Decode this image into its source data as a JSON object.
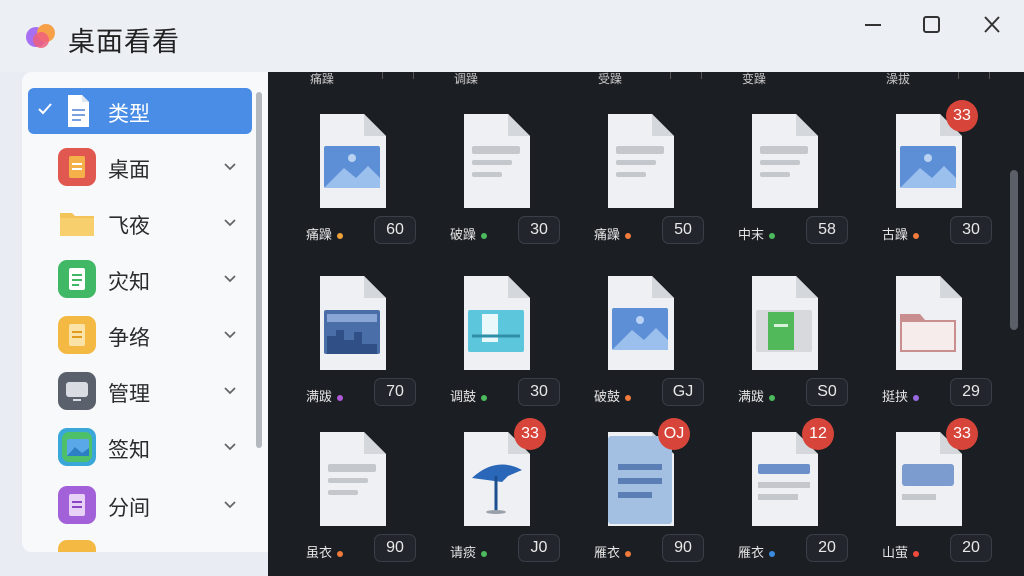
{
  "window": {
    "title": "桌面看看"
  },
  "sidebar": {
    "items": [
      {
        "label": "类型",
        "icon": "document-icon",
        "color": "#ffffff",
        "selected": true
      },
      {
        "label": "桌面",
        "icon": "files-icon",
        "color": "#e0584f"
      },
      {
        "label": "飞夜",
        "icon": "folder-icon",
        "color": "#f3c45a"
      },
      {
        "label": "灾知",
        "icon": "sheet-icon",
        "color": "#41b866"
      },
      {
        "label": "争络",
        "icon": "notes-icon",
        "color": "#f4b943"
      },
      {
        "label": "管理",
        "icon": "monitor-icon",
        "color": "#5b616c"
      },
      {
        "label": "签知",
        "icon": "gallery-icon",
        "color": "#3aa7d9"
      },
      {
        "label": "分间",
        "icon": "purple-doc-icon",
        "color": "#a261d8"
      }
    ]
  },
  "grid": {
    "top_fragments": [
      "痛躁",
      "调躁",
      "受躁",
      "变躁",
      "澡拔"
    ],
    "rows": [
      [
        {
          "name": "痛躁",
          "count": "60",
          "dot": "#f0a23a",
          "type": "image"
        },
        {
          "name": "破躁",
          "count": "30",
          "dot": "#4bbb5e",
          "type": "text"
        },
        {
          "name": "痛躁",
          "count": "50",
          "dot": "#f07b3a",
          "type": "text"
        },
        {
          "name": "中末",
          "count": "58",
          "dot": "#4bbb5e",
          "type": "text"
        },
        {
          "name": "古躁",
          "count": "30",
          "dot": "#f07b3a",
          "type": "image",
          "badge": "33"
        }
      ],
      [
        {
          "name": "满跋",
          "count": "70",
          "dot": "#b05ad8",
          "type": "web"
        },
        {
          "name": "调鼓",
          "count": "30",
          "dot": "#4bbb5e",
          "type": "teal"
        },
        {
          "name": "破鼓",
          "count": "GJ",
          "dot": "#f07b3a",
          "type": "image"
        },
        {
          "name": "满跋",
          "count": "S0",
          "dot": "#4bbb5e",
          "type": "green"
        },
        {
          "name": "挺挟",
          "count": "29",
          "dot": "#9a6ae0",
          "type": "folder"
        }
      ],
      [
        {
          "name": "虽衣",
          "count": "90",
          "dot": "#f07b3a",
          "type": "text"
        },
        {
          "name": "请痰",
          "count": "J0",
          "dot": "#4bbb5e",
          "type": "umbrella",
          "badge": "33"
        },
        {
          "name": "雁衣",
          "count": "90",
          "dot": "#f07b3a",
          "type": "bluedoc",
          "badge": "OJ"
        },
        {
          "name": "雁衣",
          "count": "20",
          "dot": "#3a8ae0",
          "type": "bluetext",
          "badge": "12"
        },
        {
          "name": "山萤",
          "count": "20",
          "dot": "#f04a3a",
          "type": "bluebar",
          "badge": "33"
        }
      ]
    ]
  }
}
